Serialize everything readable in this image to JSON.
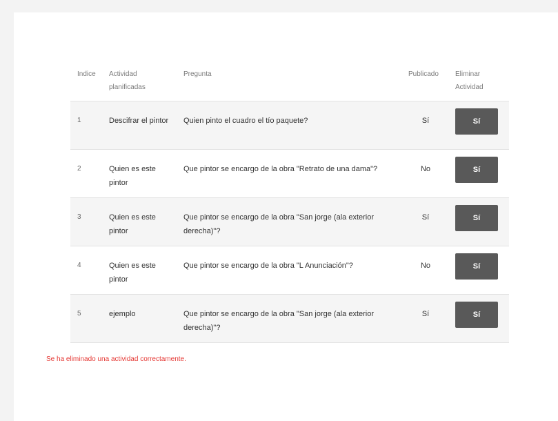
{
  "table": {
    "headers": {
      "indice": "Indice",
      "actividad": "Actividad planificadas",
      "pregunta": "Pregunta",
      "publicado": "Publicado",
      "eliminar": "Eliminar Actividad"
    },
    "rows": [
      {
        "indice": "1",
        "actividad": "Descifrar el pintor",
        "pregunta": "Quien pinto el cuadro el tío paquete?",
        "publicado": "Sí",
        "eliminar": "Sí"
      },
      {
        "indice": "2",
        "actividad": "Quien es este pintor",
        "pregunta": "Que pintor se encargo de la obra \"Retrato de una dama\"?",
        "publicado": "No",
        "eliminar": "Sí"
      },
      {
        "indice": "3",
        "actividad": "Quien es este pintor",
        "pregunta": "Que pintor se encargo de la obra \"San jorge (ala exterior derecha)\"?",
        "publicado": "Sí",
        "eliminar": "Sí"
      },
      {
        "indice": "4",
        "actividad": "Quien es este pintor",
        "pregunta": "Que pintor se encargo de la obra \"L Anunciación\"?",
        "publicado": "No",
        "eliminar": "Sí"
      },
      {
        "indice": "5",
        "actividad": "ejemplo",
        "pregunta": "Que pintor se encargo de la obra \"San jorge (ala exterior derecha)\"?",
        "publicado": "Sí",
        "eliminar": "Sí"
      }
    ]
  },
  "status": {
    "message": "Se ha eliminado una actividad correctamente.",
    "color": "#e53935"
  },
  "colors": {
    "button_bg": "#595959",
    "row_alt_bg": "#f5f5f5"
  }
}
